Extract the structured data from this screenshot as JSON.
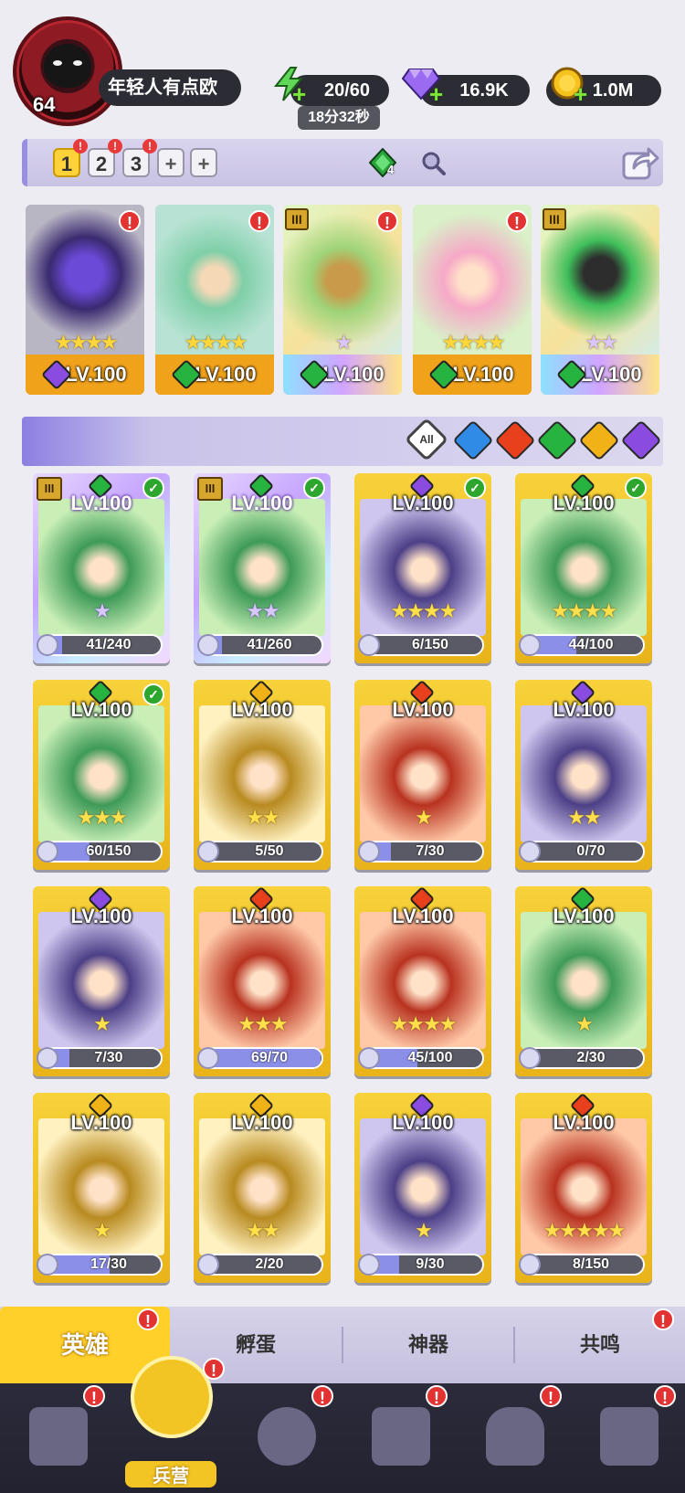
{
  "player": {
    "level": "64",
    "name": "年轻人有点欧"
  },
  "resources": {
    "energy": "20/60",
    "energy_timer": "18分32秒",
    "gems": "16.9K",
    "gold": "1.0M"
  },
  "team_bar": {
    "tabs": [
      "1",
      "2",
      "3",
      "+",
      "+"
    ],
    "active_tab": "1",
    "gem_badge_count": "4"
  },
  "team_slots": [
    {
      "level": "LV.100",
      "stars": "★★★★",
      "element": "dark",
      "alert": "!"
    },
    {
      "level": "LV.100",
      "stars": "★★★★",
      "element": "nature",
      "alert": "!"
    },
    {
      "level": "LV.100",
      "stars": "★",
      "element": "nature",
      "alert": "!",
      "tier": "III"
    },
    {
      "level": "LV.100",
      "stars": "★★★★",
      "element": "nature",
      "alert": "!"
    },
    {
      "level": "LV.100",
      "stars": "★★",
      "element": "nature",
      "alert": ""
    }
  ],
  "filters": {
    "all_label": "All",
    "elements": [
      "water",
      "fire",
      "nature",
      "light",
      "dark"
    ]
  },
  "heroes": [
    {
      "level": "LV.100",
      "progress": "41/240",
      "fill": 0.17,
      "element": "nature",
      "stars": "★",
      "purple": true,
      "tier": "III",
      "check": true
    },
    {
      "level": "LV.100",
      "progress": "41/260",
      "fill": 0.16,
      "element": "nature",
      "stars": "★★",
      "purple": true,
      "tier": "III",
      "check": true
    },
    {
      "level": "LV.100",
      "progress": "6/150",
      "fill": 0.04,
      "element": "dark",
      "stars": "★★★★",
      "purple": false,
      "tier": "",
      "check": true
    },
    {
      "level": "LV.100",
      "progress": "44/100",
      "fill": 0.44,
      "element": "nature",
      "stars": "★★★★",
      "purple": false,
      "tier": "",
      "check": true
    },
    {
      "level": "LV.100",
      "progress": "60/150",
      "fill": 0.4,
      "element": "nature",
      "stars": "★★★",
      "purple": false,
      "tier": "",
      "check": true
    },
    {
      "level": "LV.100",
      "progress": "5/50",
      "fill": 0.1,
      "element": "light",
      "stars": "★★",
      "purple": false,
      "tier": "",
      "check": false
    },
    {
      "level": "LV.100",
      "progress": "7/30",
      "fill": 0.23,
      "element": "fire",
      "stars": "★",
      "purple": false,
      "tier": "",
      "check": false
    },
    {
      "level": "LV.100",
      "progress": "0/70",
      "fill": 0.0,
      "element": "dark",
      "stars": "★★",
      "purple": false,
      "tier": "",
      "check": false
    },
    {
      "level": "LV.100",
      "progress": "7/30",
      "fill": 0.23,
      "element": "dark",
      "stars": "★",
      "purple": false,
      "tier": "",
      "check": false
    },
    {
      "level": "LV.100",
      "progress": "69/70",
      "fill": 0.99,
      "element": "fire",
      "stars": "★★★",
      "purple": false,
      "tier": "",
      "check": false
    },
    {
      "level": "LV.100",
      "progress": "45/100",
      "fill": 0.45,
      "element": "fire",
      "stars": "★★★★",
      "purple": false,
      "tier": "",
      "check": false
    },
    {
      "level": "LV.100",
      "progress": "2/30",
      "fill": 0.07,
      "element": "nature",
      "stars": "★",
      "purple": false,
      "tier": "",
      "check": false
    },
    {
      "level": "LV.100",
      "progress": "17/30",
      "fill": 0.57,
      "element": "light",
      "stars": "★",
      "purple": false,
      "tier": "",
      "check": false
    },
    {
      "level": "LV.100",
      "progress": "2/20",
      "fill": 0.1,
      "element": "light",
      "stars": "★★",
      "purple": false,
      "tier": "",
      "check": false
    },
    {
      "level": "LV.100",
      "progress": "9/30",
      "fill": 0.3,
      "element": "dark",
      "stars": "★",
      "purple": false,
      "tier": "",
      "check": false
    },
    {
      "level": "LV.100",
      "progress": "8/150",
      "fill": 0.05,
      "element": "fire",
      "stars": "★★★★★",
      "purple": false,
      "tier": "",
      "check": false
    }
  ],
  "sub_tabs": [
    "英雄",
    "孵蛋",
    "神器",
    "共鸣"
  ],
  "bottom_nav": [
    {
      "label": "",
      "icon": "cards-icon"
    },
    {
      "label": "兵营",
      "icon": "barracks-icon"
    },
    {
      "label": "",
      "icon": "map-icon"
    },
    {
      "label": "",
      "icon": "castle-icon"
    },
    {
      "label": "",
      "icon": "mushroom-icon"
    },
    {
      "label": "",
      "icon": "guild-icon"
    }
  ],
  "colors": {
    "water": "#2f8be6",
    "fire": "#e8401c",
    "nature": "#27b340",
    "light": "#f0b216",
    "dark": "#8a4be0",
    "accent_yellow": "#ffd02a",
    "alert_red": "#e23232"
  }
}
